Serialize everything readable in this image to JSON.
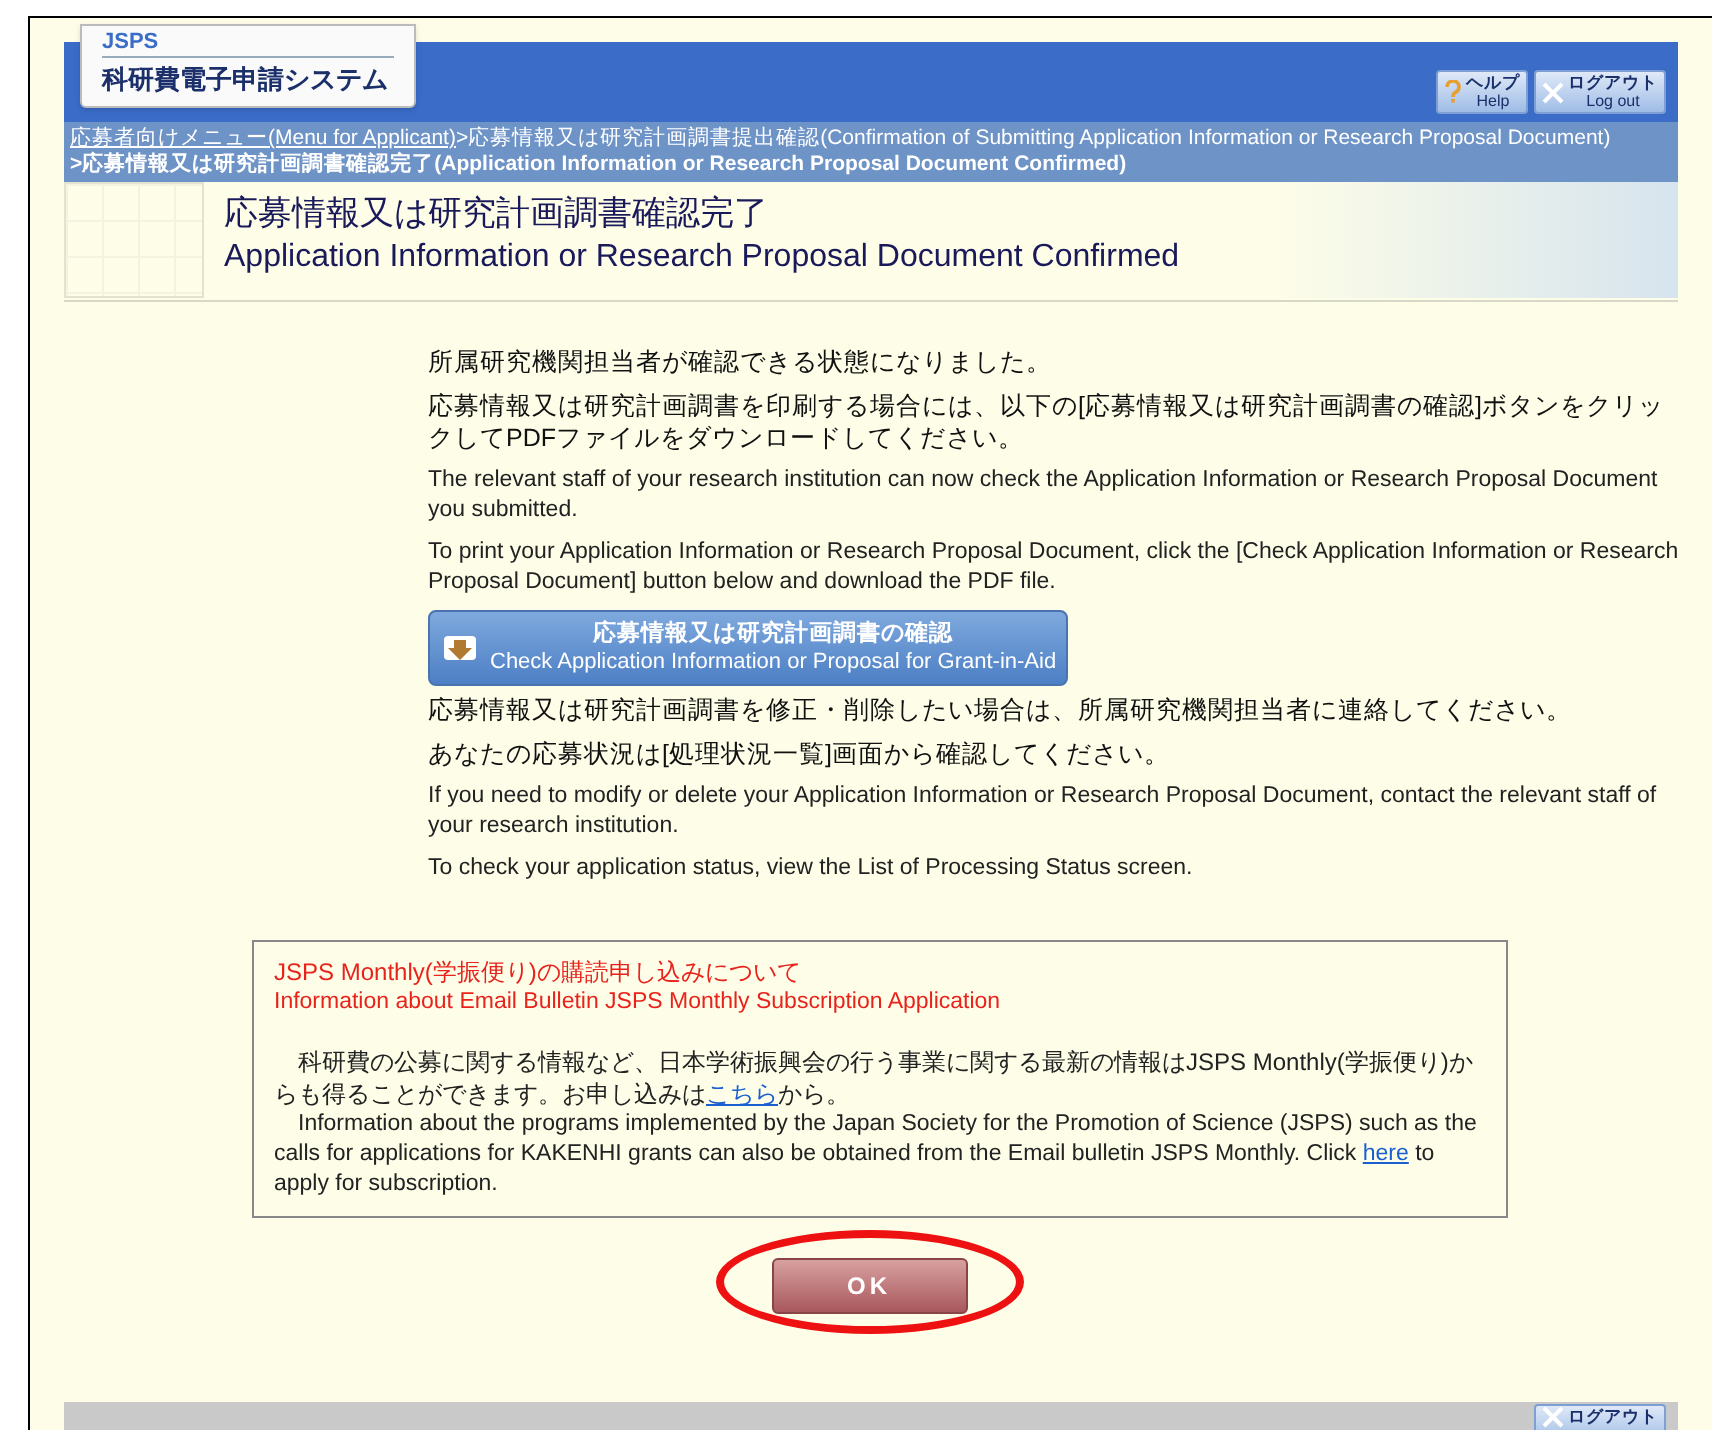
{
  "header": {
    "logo_top": "JSPS",
    "logo_title": "科研費電子申請システム",
    "buttons": [
      {
        "kind": "help",
        "ja": "ヘルプ",
        "en": "Help"
      },
      {
        "kind": "logout",
        "ja": "ログアウト",
        "en": "Log out"
      }
    ]
  },
  "breadcrumb": {
    "link": "応募者向けメニュー(Menu for Applicant)",
    "text": ">応募情報又は研究計画調書提出確認(Confirmation of Submitting Application Information or Research Proposal Document)",
    "current": ">応募情報又は研究計画調書確認完了(Application Information or Research Proposal Document Confirmed)"
  },
  "title": {
    "ja": "応募情報又は研究計画調書確認完了",
    "en": "Application Information or Research Proposal Document Confirmed"
  },
  "messages_top": [
    {
      "kind": "ja",
      "text": "所属研究機関担当者が確認できる状態になりました。"
    },
    {
      "kind": "ja",
      "text": "応募情報又は研究計画調書を印刷する場合には、以下の[応募情報又は研究計画調書の確認]ボタンをクリックしてPDFファイルをダウンロードしてください。"
    },
    {
      "kind": "en",
      "text": "The relevant staff of your research institution can now check the Application Information or Research Proposal Document you submitted."
    },
    {
      "kind": "en",
      "text": "To print your Application Information or Research Proposal Document, click the [Check Application Information or Research Proposal Document] button below and download the PDF file."
    }
  ],
  "check_button": {
    "ja": "応募情報又は研究計画調書の確認",
    "en": "Check Application Information or Proposal for Grant-in-Aid"
  },
  "messages_bottom": [
    {
      "kind": "ja",
      "text": "応募情報又は研究計画調書を修正・削除したい場合は、所属研究機関担当者に連絡してください。"
    },
    {
      "kind": "ja",
      "text": "あなたの応募状況は[処理状況一覧]画面から確認してください。"
    },
    {
      "kind": "en",
      "text": "If you need to modify or delete your Application Information or Research Proposal Document, contact the relevant staff of your research institution."
    },
    {
      "kind": "en",
      "text": "To check your application status, view the List of Processing Status screen."
    }
  ],
  "notice": {
    "title_ja": "JSPS Monthly(学振便り)の購読申し込みについて",
    "title_en": "Information about Email Bulletin JSPS Monthly Subscription Application",
    "body": [
      [
        {
          "kind": "text",
          "text": "科研費の公募に関する情報など、日本学術振興会の行う事業に関する最新の情報はJSPS Monthly(学振便り)からも得ることができます。お申し込みは"
        },
        {
          "kind": "link",
          "text": "こちら"
        },
        {
          "kind": "text",
          "text": "から。"
        }
      ],
      [
        {
          "kind": "text",
          "text": "Information about the programs implemented by the Japan Society for the Promotion of Science (JSPS) such as the calls for applications for KAKENHI grants can also be obtained from the Email bulletin JSPS Monthly. Click "
        },
        {
          "kind": "link",
          "text": "here"
        },
        {
          "kind": "text",
          "text": " to apply for subscription."
        }
      ]
    ]
  },
  "ok_button": {
    "label": "OK",
    "highlighted": true
  },
  "footer": {
    "logout": "ログアウト"
  }
}
